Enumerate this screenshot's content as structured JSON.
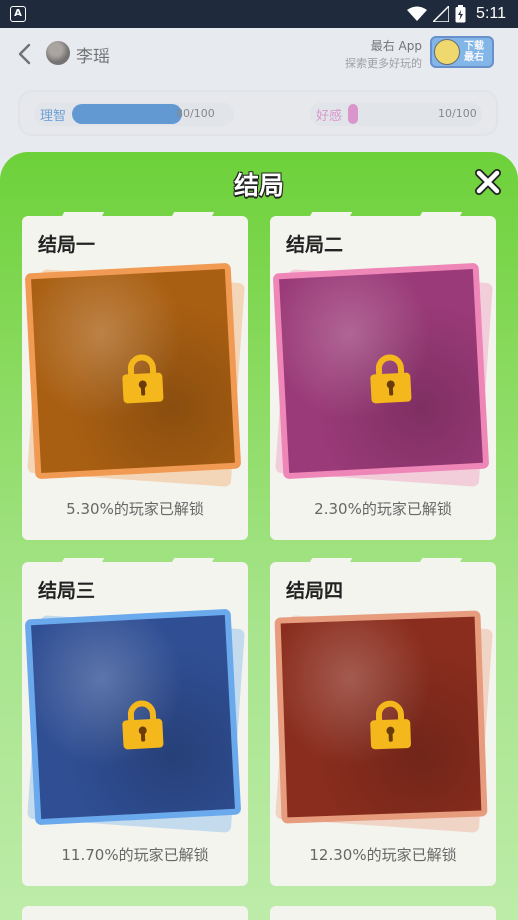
{
  "status_bar": {
    "time": "5:11",
    "app_icon_letter": "A"
  },
  "header": {
    "character_name": "李瑶",
    "promo_title": "最右 App",
    "promo_subtitle": "探索更多好玩的",
    "promo_button_line1": "下载",
    "promo_button_line2": "最右"
  },
  "stats": {
    "reason": {
      "label": "理智",
      "value_text": "80/100",
      "progress": 0.8,
      "color": "#1e6fc4"
    },
    "favor": {
      "label": "好感",
      "value_text": "10/100",
      "progress": 0.1,
      "color": "#d46bb8"
    }
  },
  "modal": {
    "title": "结局",
    "endings": [
      {
        "title": "结局一",
        "unlock_text": "5.30%的玩家已解锁",
        "frame_color": "#f09a53",
        "fill_color": "#a95f12",
        "locked": true
      },
      {
        "title": "结局二",
        "unlock_text": "2.30%的玩家已解锁",
        "frame_color": "#ef86b8",
        "fill_color": "#9a3a78",
        "locked": true
      },
      {
        "title": "结局三",
        "unlock_text": "11.70%的玩家已解锁",
        "frame_color": "#6aa9ec",
        "fill_color": "#2f4e93",
        "locked": true
      },
      {
        "title": "结局四",
        "unlock_text": "12.30%的玩家已解锁",
        "frame_color": "#e79c7e",
        "fill_color": "#8a2d1e",
        "locked": true
      }
    ]
  },
  "colors": {
    "sheet_top": "#6dd13a",
    "sheet_bottom": "#bdeca9",
    "lock": "#f5b81c"
  }
}
